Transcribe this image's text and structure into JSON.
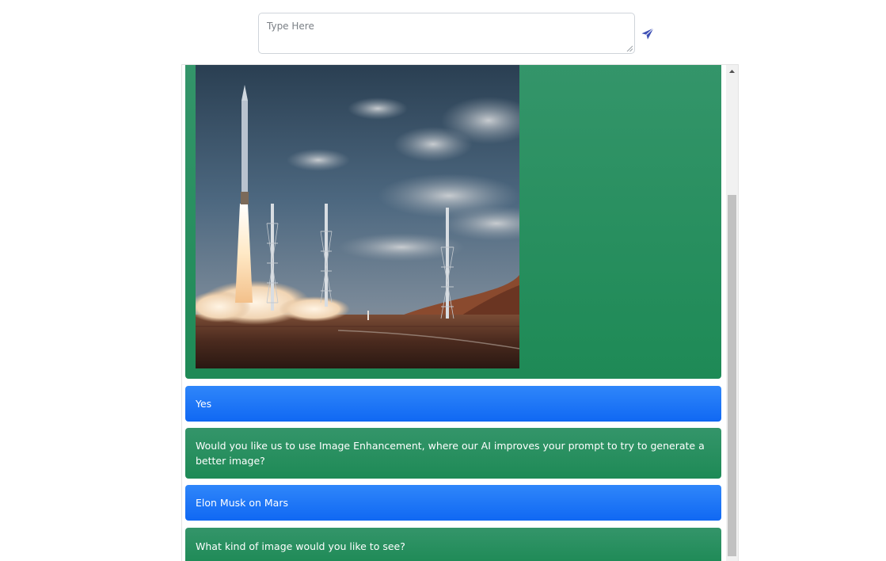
{
  "composer": {
    "placeholder": "Type Here",
    "value": ""
  },
  "send_button": {
    "icon": "paper-plane-icon",
    "color": "#3f51b5"
  },
  "colors": {
    "bot_bubble": "#1e8a56",
    "user_bubble": "#1068f3",
    "bot_text": "#ffffff",
    "user_text": "#ffffff"
  },
  "messages": [
    {
      "role": "bot",
      "type": "image",
      "image": "rocket-launch-image"
    },
    {
      "role": "user",
      "type": "text",
      "text": "Yes"
    },
    {
      "role": "bot",
      "type": "text",
      "text": "Would you like us to use Image Enhancement, where our AI improves your prompt to try to generate a better image?"
    },
    {
      "role": "user",
      "type": "text",
      "text": "Elon Musk on Mars"
    },
    {
      "role": "bot",
      "type": "text",
      "text": "What kind of image would you like to see?"
    }
  ],
  "scrollbar": {
    "up_icon": "scroll-up-arrow-icon"
  }
}
